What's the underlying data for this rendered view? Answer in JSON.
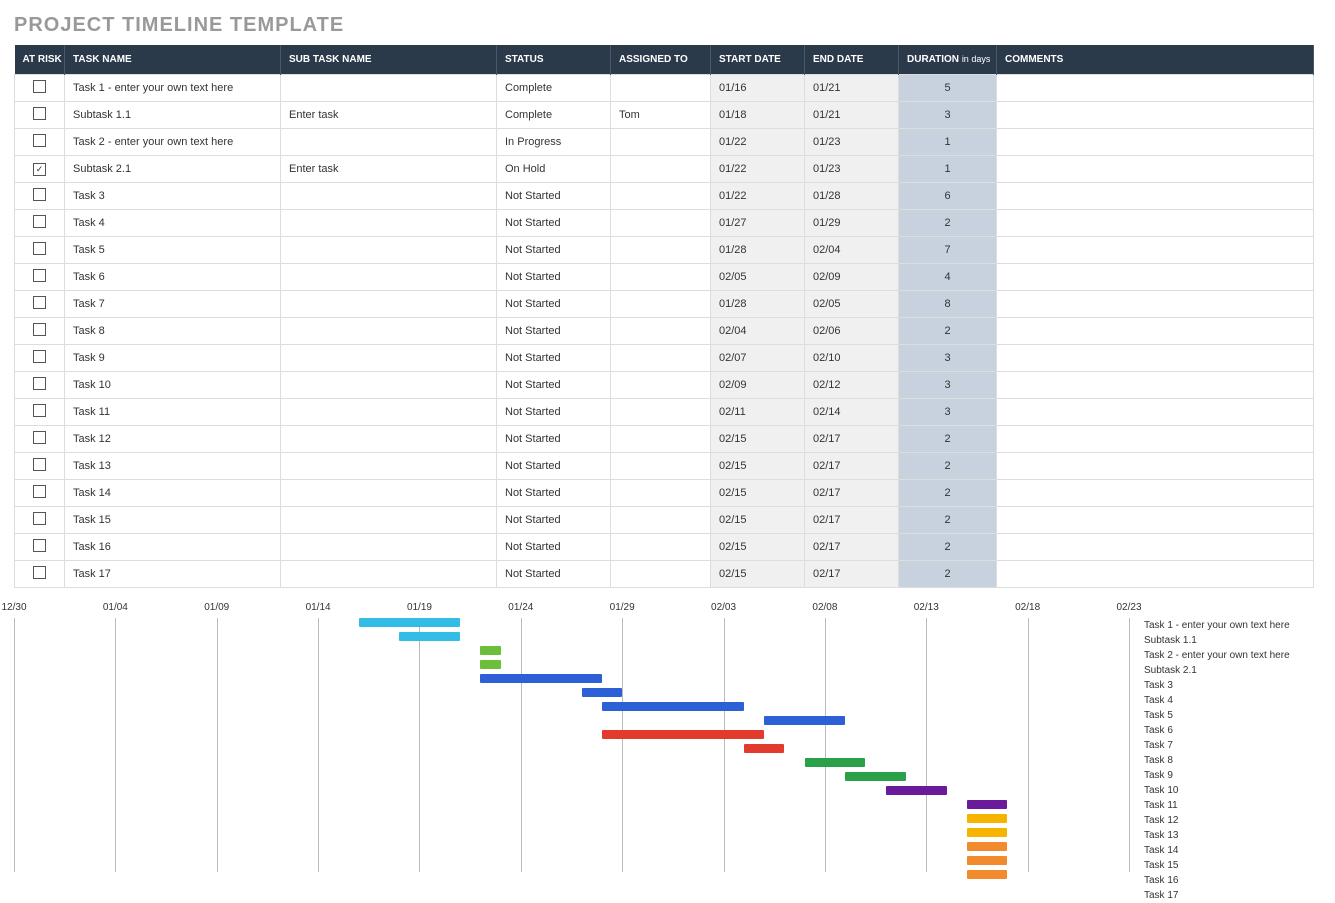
{
  "title": "PROJECT TIMELINE TEMPLATE",
  "columns": {
    "risk": "AT RISK",
    "task": "TASK NAME",
    "subtask": "SUB TASK NAME",
    "status": "STATUS",
    "assigned": "ASSIGNED TO",
    "start": "START DATE",
    "end": "END DATE",
    "duration": "DURATION",
    "duration_unit": "in days",
    "comments": "COMMENTS"
  },
  "rows": [
    {
      "risk": false,
      "task": "Task 1 - enter your own text here",
      "sub": "",
      "status": "Complete",
      "assigned": "",
      "start": "01/16",
      "end": "01/21",
      "dur": "5",
      "comments": ""
    },
    {
      "risk": false,
      "task": "Subtask 1.1",
      "sub": "Enter task",
      "status": "Complete",
      "assigned": "Tom",
      "start": "01/18",
      "end": "01/21",
      "dur": "3",
      "comments": ""
    },
    {
      "risk": false,
      "task": "Task 2 - enter your own text here",
      "sub": "",
      "status": "In Progress",
      "assigned": "",
      "start": "01/22",
      "end": "01/23",
      "dur": "1",
      "comments": ""
    },
    {
      "risk": true,
      "task": "Subtask 2.1",
      "sub": "Enter task",
      "status": "On Hold",
      "assigned": "",
      "start": "01/22",
      "end": "01/23",
      "dur": "1",
      "comments": ""
    },
    {
      "risk": false,
      "task": "Task 3",
      "sub": "",
      "status": "Not Started",
      "assigned": "",
      "start": "01/22",
      "end": "01/28",
      "dur": "6",
      "comments": ""
    },
    {
      "risk": false,
      "task": "Task 4",
      "sub": "",
      "status": "Not Started",
      "assigned": "",
      "start": "01/27",
      "end": "01/29",
      "dur": "2",
      "comments": ""
    },
    {
      "risk": false,
      "task": "Task 5",
      "sub": "",
      "status": "Not Started",
      "assigned": "",
      "start": "01/28",
      "end": "02/04",
      "dur": "7",
      "comments": ""
    },
    {
      "risk": false,
      "task": "Task 6",
      "sub": "",
      "status": "Not Started",
      "assigned": "",
      "start": "02/05",
      "end": "02/09",
      "dur": "4",
      "comments": ""
    },
    {
      "risk": false,
      "task": "Task 7",
      "sub": "",
      "status": "Not Started",
      "assigned": "",
      "start": "01/28",
      "end": "02/05",
      "dur": "8",
      "comments": ""
    },
    {
      "risk": false,
      "task": "Task 8",
      "sub": "",
      "status": "Not Started",
      "assigned": "",
      "start": "02/04",
      "end": "02/06",
      "dur": "2",
      "comments": ""
    },
    {
      "risk": false,
      "task": "Task 9",
      "sub": "",
      "status": "Not Started",
      "assigned": "",
      "start": "02/07",
      "end": "02/10",
      "dur": "3",
      "comments": ""
    },
    {
      "risk": false,
      "task": "Task 10",
      "sub": "",
      "status": "Not Started",
      "assigned": "",
      "start": "02/09",
      "end": "02/12",
      "dur": "3",
      "comments": ""
    },
    {
      "risk": false,
      "task": "Task 11",
      "sub": "",
      "status": "Not Started",
      "assigned": "",
      "start": "02/11",
      "end": "02/14",
      "dur": "3",
      "comments": ""
    },
    {
      "risk": false,
      "task": "Task 12",
      "sub": "",
      "status": "Not Started",
      "assigned": "",
      "start": "02/15",
      "end": "02/17",
      "dur": "2",
      "comments": ""
    },
    {
      "risk": false,
      "task": "Task 13",
      "sub": "",
      "status": "Not Started",
      "assigned": "",
      "start": "02/15",
      "end": "02/17",
      "dur": "2",
      "comments": ""
    },
    {
      "risk": false,
      "task": "Task 14",
      "sub": "",
      "status": "Not Started",
      "assigned": "",
      "start": "02/15",
      "end": "02/17",
      "dur": "2",
      "comments": ""
    },
    {
      "risk": false,
      "task": "Task 15",
      "sub": "",
      "status": "Not Started",
      "assigned": "",
      "start": "02/15",
      "end": "02/17",
      "dur": "2",
      "comments": ""
    },
    {
      "risk": false,
      "task": "Task 16",
      "sub": "",
      "status": "Not Started",
      "assigned": "",
      "start": "02/15",
      "end": "02/17",
      "dur": "2",
      "comments": ""
    },
    {
      "risk": false,
      "task": "Task 17",
      "sub": "",
      "status": "Not Started",
      "assigned": "",
      "start": "02/15",
      "end": "02/17",
      "dur": "2",
      "comments": ""
    }
  ],
  "chart_data": {
    "type": "bar",
    "title": "",
    "xlabel": "",
    "ylabel": "",
    "x_ticks": [
      "12/30",
      "01/04",
      "01/09",
      "01/14",
      "01/19",
      "01/24",
      "01/29",
      "02/03",
      "02/08",
      "02/13",
      "02/18",
      "02/23"
    ],
    "x_range_days": [
      0,
      55
    ],
    "day_zero": "12/30",
    "series": [
      {
        "name": "Task 1 - enter your own text here",
        "start_day": 17,
        "dur": 5,
        "color": "#33bce6"
      },
      {
        "name": "Subtask 1.1",
        "start_day": 19,
        "dur": 3,
        "color": "#33bce6"
      },
      {
        "name": "Task 2 - enter your own text here",
        "start_day": 23,
        "dur": 1,
        "color": "#6bbf3a"
      },
      {
        "name": "Subtask 2.1",
        "start_day": 23,
        "dur": 1,
        "color": "#6bbf3a"
      },
      {
        "name": "Task 3",
        "start_day": 23,
        "dur": 6,
        "color": "#2d5fd6"
      },
      {
        "name": "Task 4",
        "start_day": 28,
        "dur": 2,
        "color": "#2d5fd6"
      },
      {
        "name": "Task 5",
        "start_day": 29,
        "dur": 7,
        "color": "#2d5fd6"
      },
      {
        "name": "Task 6",
        "start_day": 37,
        "dur": 4,
        "color": "#2d5fd6"
      },
      {
        "name": "Task 7",
        "start_day": 29,
        "dur": 8,
        "color": "#e23b2e"
      },
      {
        "name": "Task 8",
        "start_day": 36,
        "dur": 2,
        "color": "#e23b2e"
      },
      {
        "name": "Task 9",
        "start_day": 39,
        "dur": 3,
        "color": "#2aa04b"
      },
      {
        "name": "Task 10",
        "start_day": 41,
        "dur": 3,
        "color": "#2aa04b"
      },
      {
        "name": "Task 11",
        "start_day": 43,
        "dur": 3,
        "color": "#6a1b9a"
      },
      {
        "name": "Task 12",
        "start_day": 47,
        "dur": 2,
        "color": "#6a1b9a"
      },
      {
        "name": "Task 13",
        "start_day": 47,
        "dur": 2,
        "color": "#f6b400"
      },
      {
        "name": "Task 14",
        "start_day": 47,
        "dur": 2,
        "color": "#f6b400"
      },
      {
        "name": "Task 15",
        "start_day": 47,
        "dur": 2,
        "color": "#f28a2e"
      },
      {
        "name": "Task 16",
        "start_day": 47,
        "dur": 2,
        "color": "#f28a2e"
      },
      {
        "name": "Task 17",
        "start_day": 47,
        "dur": 2,
        "color": "#f28a2e"
      }
    ]
  }
}
